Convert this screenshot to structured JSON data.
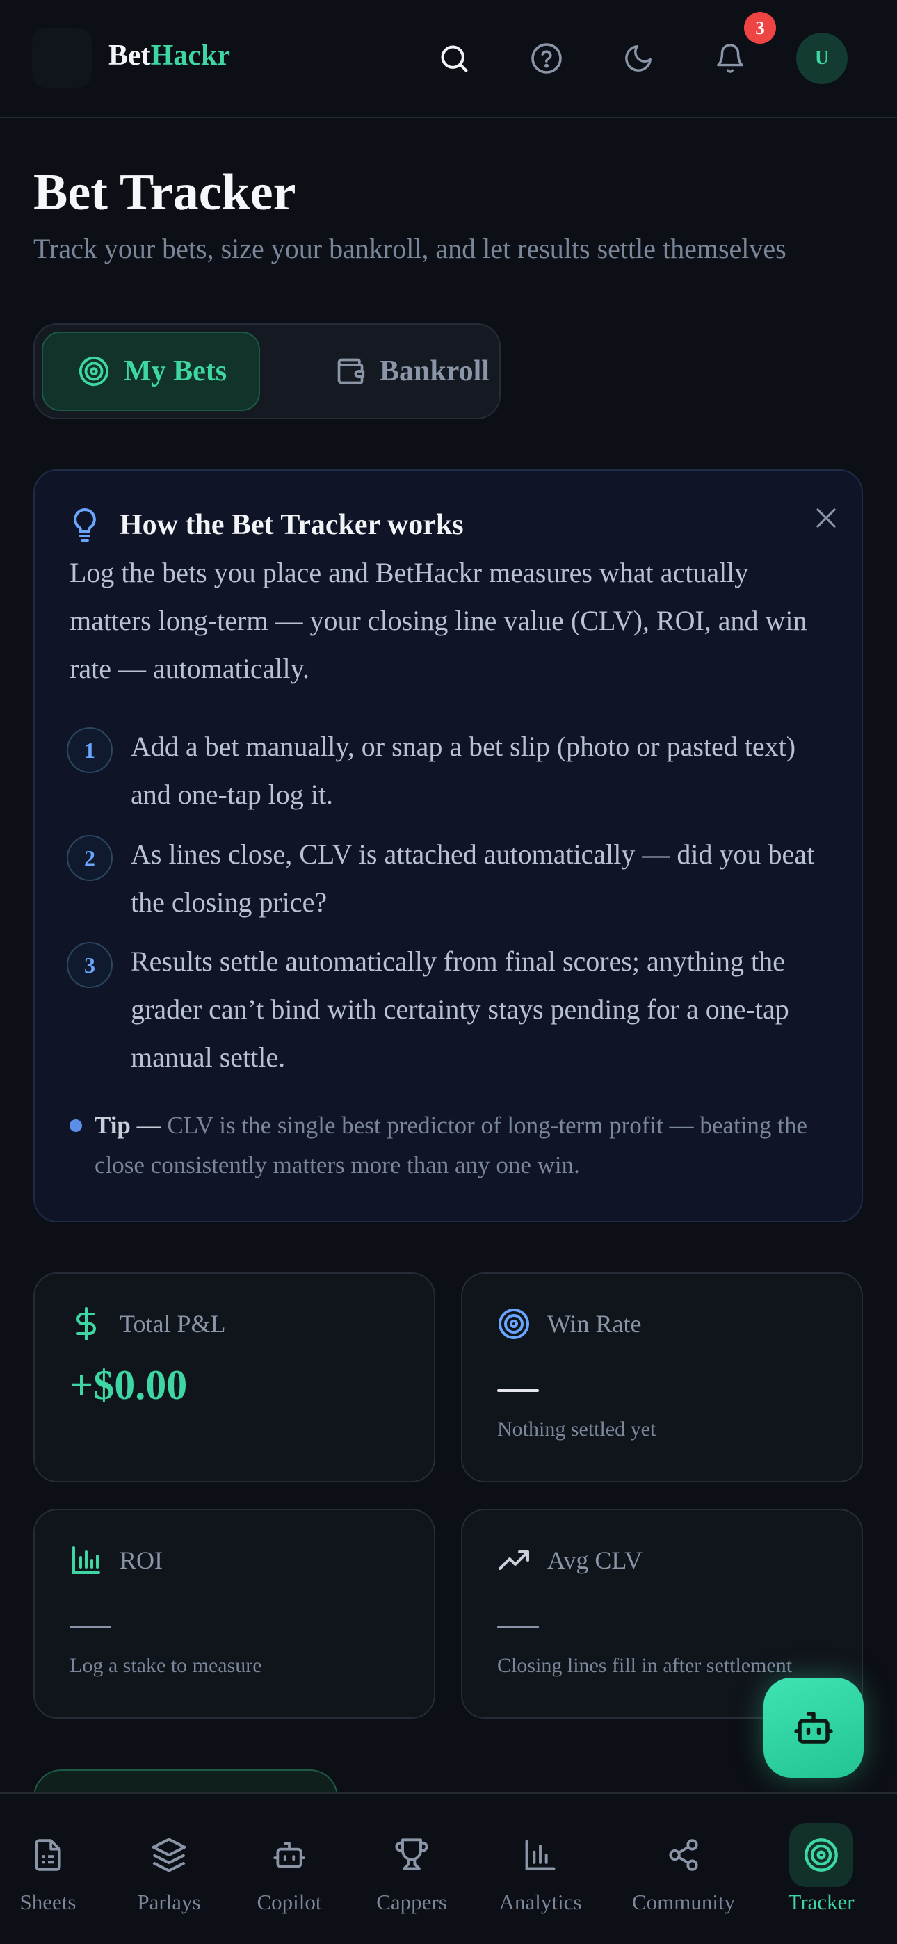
{
  "header": {
    "brand_part1": "Bet",
    "brand_part2": "Hackr",
    "notification_count": "3",
    "avatar_initial": "U"
  },
  "page": {
    "title": "Bet Tracker",
    "subtitle": "Track your bets, size your bankroll, and let results settle themselves"
  },
  "tabs": [
    {
      "label": "My Bets",
      "icon": "target-icon",
      "active": true
    },
    {
      "label": "Bankroll",
      "icon": "wallet-icon",
      "active": false
    }
  ],
  "info": {
    "title": "How the Bet Tracker works",
    "body": "Log the bets you place and BetHackr measures what actually matters long-term — your closing line value (CLV), ROI, and win rate — automatically.",
    "steps": [
      {
        "number": "1",
        "text": "Add a bet manually, or snap a bet slip (photo or pasted text) and one-tap log it."
      },
      {
        "number": "2",
        "text": "As lines close, CLV is attached automatically — did you beat the closing price?"
      },
      {
        "number": "3",
        "text": "Results settle automatically from final scores; anything the grader can’t bind with certainty stays pending for a one-tap manual settle."
      }
    ],
    "tip_label": "Tip —",
    "tip_text": " CLV is the single best predictor of long-term profit — beating the close consistently matters more than any one win."
  },
  "stats": {
    "pnl": {
      "label": "Total P&L",
      "value": "+$0.00"
    },
    "win_rate": {
      "label": "Win Rate",
      "sub": "Nothing settled yet"
    },
    "roi": {
      "label": "ROI",
      "sub": "Log a stake to measure"
    },
    "avg_clv": {
      "label": "Avg CLV",
      "sub": "Closing lines fill in after settlement"
    }
  },
  "nav": [
    {
      "label": "Sheets",
      "icon": "document-icon"
    },
    {
      "label": "Parlays",
      "icon": "layers-icon"
    },
    {
      "label": "Copilot",
      "icon": "bot-icon"
    },
    {
      "label": "Cappers",
      "icon": "trophy-icon"
    },
    {
      "label": "Analytics",
      "icon": "bar-chart-icon"
    },
    {
      "label": "Community",
      "icon": "share-icon"
    },
    {
      "label": "Tracker",
      "icon": "target-icon",
      "active": true
    }
  ],
  "colors": {
    "accent": "#3ed6a2",
    "background": "#0c0f15",
    "card": "#10141b",
    "info_card": "#0f1526",
    "badge": "#ef4444",
    "step_number": "#6aa6ff"
  }
}
